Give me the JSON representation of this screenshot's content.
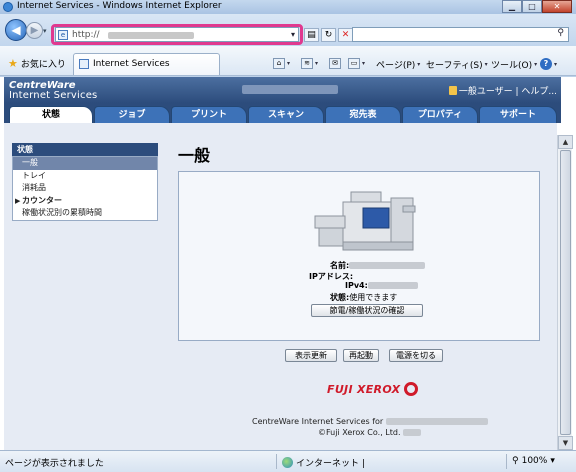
{
  "window": {
    "title": "Internet Services - Windows Internet Explorer"
  },
  "address": {
    "url": "http://"
  },
  "search": {
    "placeholder": ""
  },
  "favorites": {
    "label": "お気に入り"
  },
  "tab": {
    "label": "Internet Services"
  },
  "commands": {
    "page": "ページ(P)",
    "safety": "セーフティ(S)",
    "tools": "ツール(O)",
    "help": "?"
  },
  "cw": {
    "logo_line1": "CentreWare",
    "logo_line2": "Internet Services",
    "user": "一般ユーザー | ヘルプ..."
  },
  "tabs": [
    "状態",
    "ジョブ",
    "プリント",
    "スキャン",
    "宛先表",
    "プロパティ",
    "サポート"
  ],
  "left_nav": {
    "header": "状態",
    "items": [
      "一般",
      "トレイ",
      "消耗品",
      "カウンター",
      "稼働状況別の累積時間"
    ]
  },
  "main": {
    "title": "一般",
    "name_label": "名前:",
    "ip_label": "IPアドレス:",
    "ipv4_label": "IPv4:",
    "status_label": "状態:",
    "status_value": "使用できます",
    "power_button": "節電/稼働状況の確認",
    "refresh_button": "表示更新",
    "reboot_button": "再起動",
    "poweroff_button": "電源を切る"
  },
  "footer": {
    "brand": "FUJI XEROX",
    "line1": "CentreWare Internet Services for",
    "line2": "©Fuji Xerox Co., Ltd."
  },
  "status": {
    "text": "ページが表示されました",
    "zone": "インターネット |",
    "zoom": "100%"
  },
  "colors": {
    "header_bg": "#2c4c7c",
    "tab_bg": "#3d72b8",
    "highlight": "#e0398f",
    "brand_red": "#d01a2a"
  }
}
